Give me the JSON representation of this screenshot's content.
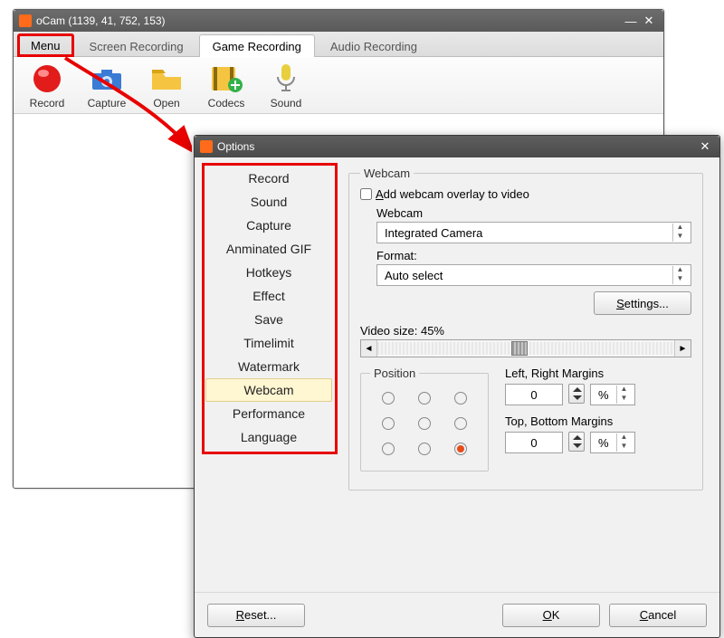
{
  "main": {
    "title": "oCam (1139, 41, 752, 153)",
    "tabs": [
      "Menu",
      "Screen Recording",
      "Game Recording",
      "Audio Recording"
    ],
    "activeTab": 2,
    "tools": [
      {
        "label": "Record"
      },
      {
        "label": "Capture"
      },
      {
        "label": "Open"
      },
      {
        "label": "Codecs"
      },
      {
        "label": "Sound"
      }
    ]
  },
  "dialog": {
    "title": "Options",
    "sidebar": [
      "Record",
      "Sound",
      "Capture",
      "Anminated GIF",
      "Hotkeys",
      "Effect",
      "Save",
      "Timelimit",
      "Watermark",
      "Webcam",
      "Performance",
      "Language"
    ],
    "selectedIndex": 9,
    "webcam": {
      "group": "Webcam",
      "addOverlay": "Add webcam overlay to video",
      "addOverlayChecked": false,
      "webcamLabel": "Webcam",
      "webcamValue": "Integrated Camera",
      "formatLabel": "Format:",
      "formatValue": "Auto select",
      "settingsBtn": "Settings...",
      "videoSizeLabel": "Video size: 45%",
      "position": {
        "legend": "Position",
        "selected": 8
      },
      "leftRight": {
        "label": "Left, Right Margins",
        "value": "0",
        "unit": "%"
      },
      "topBottom": {
        "label": "Top, Bottom Margins",
        "value": "0",
        "unit": "%"
      }
    },
    "buttons": {
      "reset": "Reset...",
      "ok": "OK",
      "cancel": "Cancel"
    }
  }
}
